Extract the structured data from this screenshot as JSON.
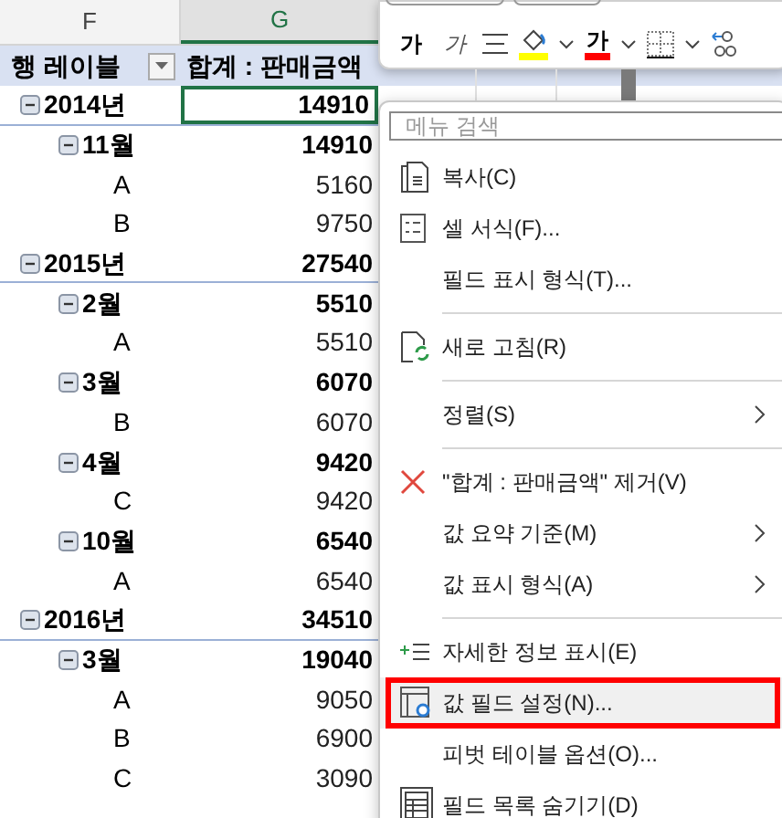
{
  "sheet": {
    "columns": [
      "F",
      "G"
    ],
    "pivot": {
      "row_label": "행 레이블",
      "value_header": "합계 : 판매금액",
      "rows": [
        {
          "label": "2014년",
          "value": "14910",
          "expanded": true,
          "children": [
            {
              "label": "11월",
              "value": "14910",
              "expanded": true,
              "children": [
                {
                  "label": "A",
                  "value": "5160"
                },
                {
                  "label": "B",
                  "value": "9750"
                }
              ]
            }
          ]
        },
        {
          "label": "2015년",
          "value": "27540",
          "expanded": true,
          "children": [
            {
              "label": "2월",
              "value": "5510",
              "expanded": true,
              "children": [
                {
                  "label": "A",
                  "value": "5510"
                }
              ]
            },
            {
              "label": "3월",
              "value": "6070",
              "expanded": true,
              "children": [
                {
                  "label": "B",
                  "value": "6070"
                }
              ]
            },
            {
              "label": "4월",
              "value": "9420",
              "expanded": true,
              "children": [
                {
                  "label": "C",
                  "value": "9420"
                }
              ]
            },
            {
              "label": "10월",
              "value": "6540",
              "expanded": true,
              "children": [
                {
                  "label": "A",
                  "value": "6540"
                }
              ]
            }
          ]
        },
        {
          "label": "2016년",
          "value": "34510",
          "expanded": true,
          "children": [
            {
              "label": "3월",
              "value": "19040",
              "expanded": true,
              "children": [
                {
                  "label": "A",
                  "value": "9050"
                },
                {
                  "label": "B",
                  "value": "6900"
                },
                {
                  "label": "C",
                  "value": "3090"
                }
              ]
            }
          ]
        }
      ]
    }
  },
  "mini_toolbar": {
    "buttons": [
      {
        "kind": "bold",
        "label": "가"
      },
      {
        "kind": "italic",
        "label": "가"
      },
      {
        "kind": "align"
      },
      {
        "kind": "fill",
        "color": "#ffff00"
      },
      {
        "kind": "caret"
      },
      {
        "kind": "fontcolor",
        "label": "가",
        "color": "#ff0000"
      },
      {
        "kind": "caret"
      },
      {
        "kind": "border"
      },
      {
        "kind": "caret"
      },
      {
        "kind": "decimal"
      }
    ]
  },
  "context_menu": {
    "search": {
      "placeholder": "메뉴 검색"
    },
    "items": [
      {
        "kind": "copy",
        "label": "복사(C)",
        "submenu": false,
        "highlighted": false
      },
      {
        "kind": "format",
        "label": "셀 서식(F)...",
        "submenu": false,
        "highlighted": false
      },
      {
        "kind": "item",
        "label": "필드 표시 형식(T)...",
        "submenu": false,
        "highlighted": false
      },
      {
        "kind": "separator"
      },
      {
        "kind": "refresh",
        "label": "새로 고침(R)",
        "submenu": false,
        "highlighted": false
      },
      {
        "kind": "separator"
      },
      {
        "kind": "item",
        "label": "정렬(S)",
        "submenu": true,
        "highlighted": false
      },
      {
        "kind": "separator"
      },
      {
        "kind": "remove",
        "label": "\"합계 : 판매금액\" 제거(V)",
        "submenu": false,
        "highlighted": false
      },
      {
        "kind": "item",
        "label": "값 요약 기준(M)",
        "submenu": true,
        "highlighted": false
      },
      {
        "kind": "item",
        "label": "값 표시 형식(A)",
        "submenu": true,
        "highlighted": false
      },
      {
        "kind": "separator"
      },
      {
        "kind": "details",
        "label": "자세한 정보 표시(E)",
        "submenu": false,
        "highlighted": false
      },
      {
        "kind": "settings",
        "label": "값 필드 설정(N)...",
        "submenu": false,
        "highlighted": true
      },
      {
        "kind": "item",
        "label": "피벗 테이블 옵션(O)...",
        "submenu": false,
        "highlighted": false
      },
      {
        "kind": "fieldlist",
        "label": "필드 목록 숨기기(D)",
        "submenu": false,
        "highlighted": false
      }
    ]
  }
}
